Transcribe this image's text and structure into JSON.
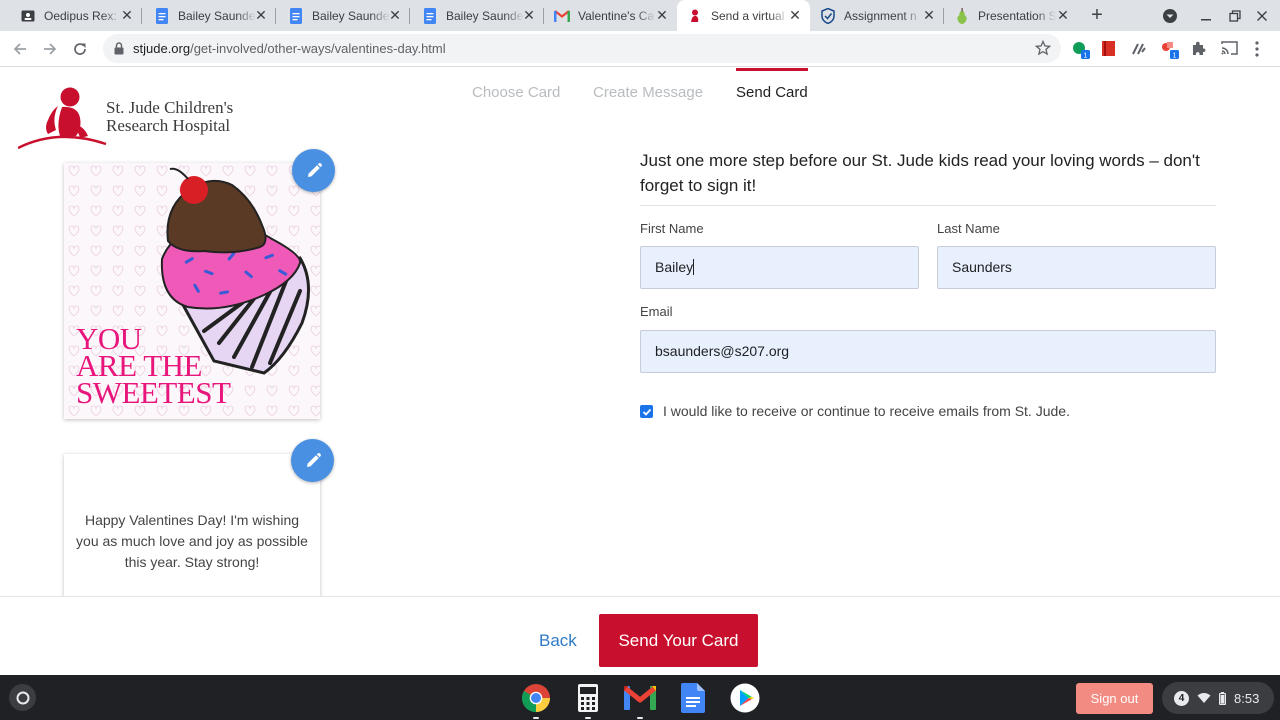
{
  "browser": {
    "tabs": [
      {
        "title": "Oedipus Rex: E",
        "icon": "classroom-icon"
      },
      {
        "title": "Bailey Saunde",
        "icon": "docs-icon"
      },
      {
        "title": "Bailey Saunde",
        "icon": "docs-icon"
      },
      {
        "title": "Bailey Saunde",
        "icon": "docs-icon"
      },
      {
        "title": "Valentine's Ca",
        "icon": "gmail-icon"
      },
      {
        "title": "Send a virtual",
        "icon": "stjude-icon",
        "active": true
      },
      {
        "title": "Assignment n",
        "icon": "shield-icon"
      },
      {
        "title": "Presentation S",
        "icon": "pear-icon"
      }
    ],
    "url_host": "stjude.org",
    "url_path": "/get-involved/other-ways/valentines-day.html"
  },
  "brand": {
    "line1": "St. Jude Children's",
    "line2": "Research Hospital",
    "color": "#c8102e"
  },
  "steps": [
    {
      "label": "Choose Card",
      "state": "done"
    },
    {
      "label": "Create Message",
      "state": "done"
    },
    {
      "label": "Send Card",
      "state": "active"
    }
  ],
  "card": {
    "front_text": [
      "YOU",
      "ARE THE",
      "SWEETEST"
    ],
    "message": "Happy Valentines Day! I'm wishing you as much love and joy as possible this year. Stay strong!"
  },
  "form": {
    "intro": "Just one more step before our St. Jude kids read your loving words – don't forget to sign it!",
    "first_name_label": "First Name",
    "first_name_value": "Bailey",
    "last_name_label": "Last Name",
    "last_name_value": "Saunders",
    "email_label": "Email",
    "email_value": "bsaunders@s207.org",
    "optin_checked": true,
    "optin_label": "I would like to receive or continue to receive emails from St. Jude."
  },
  "footer": {
    "back_label": "Back",
    "send_label": "Send Your Card"
  },
  "shelf": {
    "signout_label": "Sign out",
    "notification_count": "4",
    "time": "8:53"
  }
}
